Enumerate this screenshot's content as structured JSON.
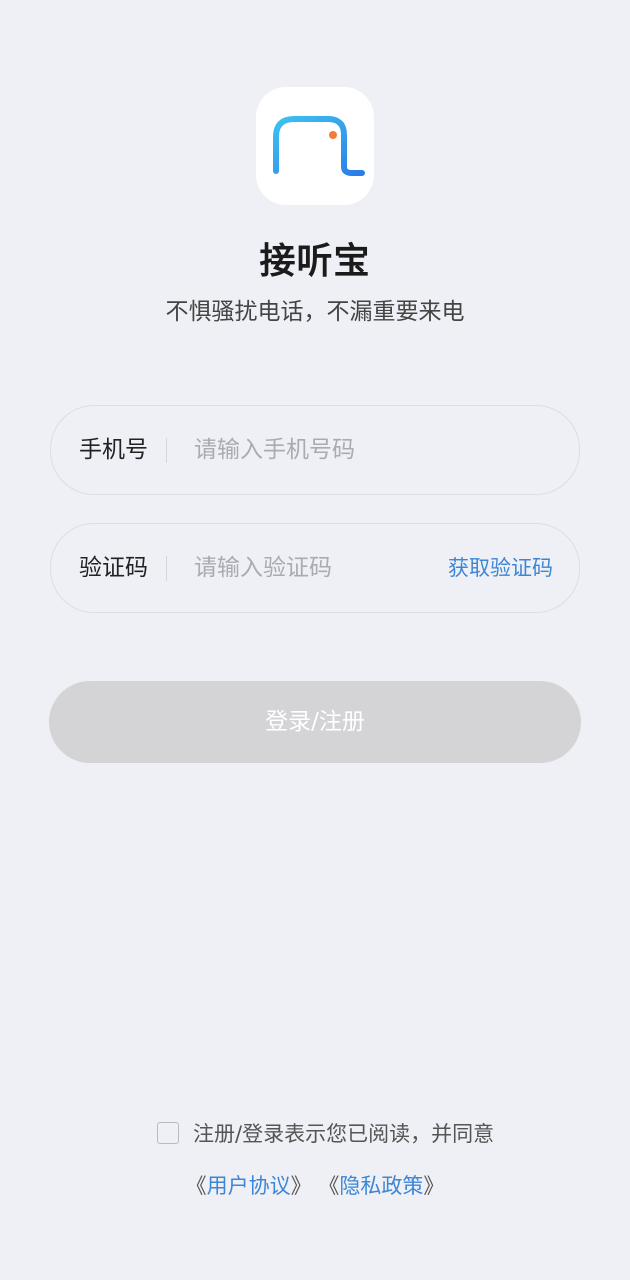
{
  "app": {
    "title": "接听宝",
    "slogan": "不惧骚扰电话，不漏重要来电"
  },
  "form": {
    "phone_label": "手机号",
    "phone_placeholder": "请输入手机号码",
    "phone_value": "",
    "code_label": "验证码",
    "code_placeholder": "请输入验证码",
    "code_value": "",
    "get_code_label": "获取验证码",
    "submit_label": "登录/注册"
  },
  "agreement": {
    "checked": false,
    "text": "注册/登录表示您已阅读，并同意",
    "open_quote": "《",
    "close_quote": "》",
    "user_agreement": "用户协议",
    "privacy_policy": "隐私政策"
  },
  "icons": {
    "logo": "app-logo-icon",
    "checkbox": "checkbox-icon"
  },
  "colors": {
    "background": "#eef0f5",
    "accent": "#3d86d6",
    "button_disabled": "#d4d4d6",
    "logo_orange": "#f07c36"
  }
}
